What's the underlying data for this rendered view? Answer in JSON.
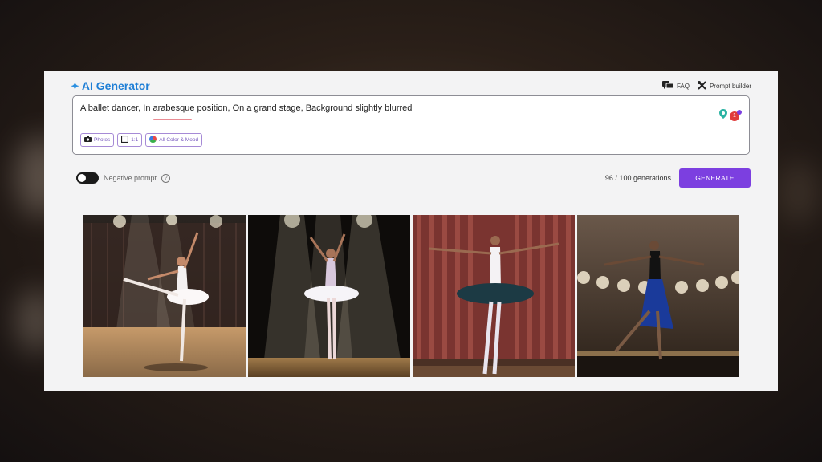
{
  "header": {
    "brand_title": "AI Generator",
    "faq_label": "FAQ",
    "prompt_builder_label": "Prompt builder"
  },
  "prompt": {
    "text": "A ballet dancer, In arabesque position, On a grand stage, Background slightly blurred",
    "notification_count": "1"
  },
  "chips": [
    {
      "label": "Photos",
      "icon": "camera-icon"
    },
    {
      "label": "1:1",
      "icon": "square-icon"
    },
    {
      "label": "All Color & Mood",
      "icon": "color-wheel-icon"
    }
  ],
  "controls": {
    "negative_prompt_label": "Negative prompt",
    "generations_count": "96 / 100 generations",
    "generate_label": "GENERATE"
  },
  "gallery": {
    "images": [
      {
        "description": "dancer-white-tutu-spotlights"
      },
      {
        "description": "dancer-white-tutu-stage-beams"
      },
      {
        "description": "dancer-dark-tutu-red-curtain"
      },
      {
        "description": "dancer-blue-skirt-stage-lights"
      }
    ]
  },
  "colors": {
    "accent": "#7c3fe0",
    "brand": "#1f7fd6",
    "chip_border": "#a68ad6"
  }
}
